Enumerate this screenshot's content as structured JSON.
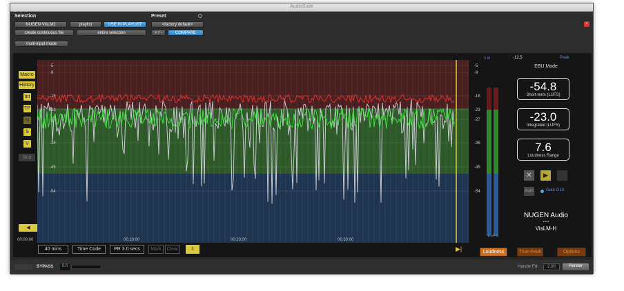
{
  "window": {
    "title": "AudioSuite"
  },
  "selection": {
    "label": "Selection",
    "plugin_select": "NUGEN VisLM2",
    "playlist": "playlist",
    "use_in_playlist": "USE IN PLAYLIST",
    "create_file": "create continuous file",
    "entire_selection": "entire selection",
    "multi_input": "multi-input mode"
  },
  "preset": {
    "label": "Preset",
    "factory": "<factory default>",
    "compare": "COMPARE",
    "pm": "+ / -"
  },
  "sidebar": {
    "macro": "Macro",
    "history": "History",
    "int": "Int",
    "tp": "TP",
    "m": "M",
    "s": "S",
    "v": "V",
    "grid": "Grid",
    "arrow": "◀"
  },
  "graph": {
    "scale_labels": [
      "-5",
      "-9",
      "-18",
      "-23",
      "-27",
      "-36",
      "-45",
      "-54"
    ],
    "time_ticks": [
      "00:00:00",
      "00:10:00",
      "00:20:00",
      "00:30:00"
    ]
  },
  "bottom": {
    "duration": "40 mins",
    "timecode": "Time Code",
    "pr": "PR 3.0 secs",
    "mark": "Mark",
    "clear": "Clear",
    "play_icon": "▶|"
  },
  "meters": {
    "header_left": "S  M",
    "header_val": "-12.5",
    "peak": "Peak",
    "scale": [
      "-5",
      "-9",
      "-18",
      "-23",
      "-27",
      "-36",
      "-45",
      "-54"
    ],
    "unit": "LUFS"
  },
  "right": {
    "mode": "EBU Mode",
    "short_term": {
      "value": "-54.8",
      "caption": "Short-term (LUFS)"
    },
    "integrated": {
      "value": "-23.0",
      "caption": "Integrated (LUFS)"
    },
    "range": {
      "value": "7.6",
      "caption": "Loudness Range"
    },
    "auto": "Auto",
    "gate": "Gate G10",
    "brand": "NUGEN Audio",
    "dots": "• • •",
    "product": "VisLM-H"
  },
  "tabs": {
    "loudness": "Loudness",
    "true_peak": "True-Peak",
    "options": "Options"
  },
  "footer": {
    "bypass": "BYPASS",
    "bypass_val": "0.0",
    "handle": "Handle Fill:",
    "handle_val": "2.00",
    "render": "Render"
  },
  "colors": {
    "red_zone": "#4a1f1f",
    "green_zone": "#2e5a2a",
    "blue_zone": "#1e3450",
    "accent": "#d9c93b",
    "orange": "#c8641a"
  }
}
